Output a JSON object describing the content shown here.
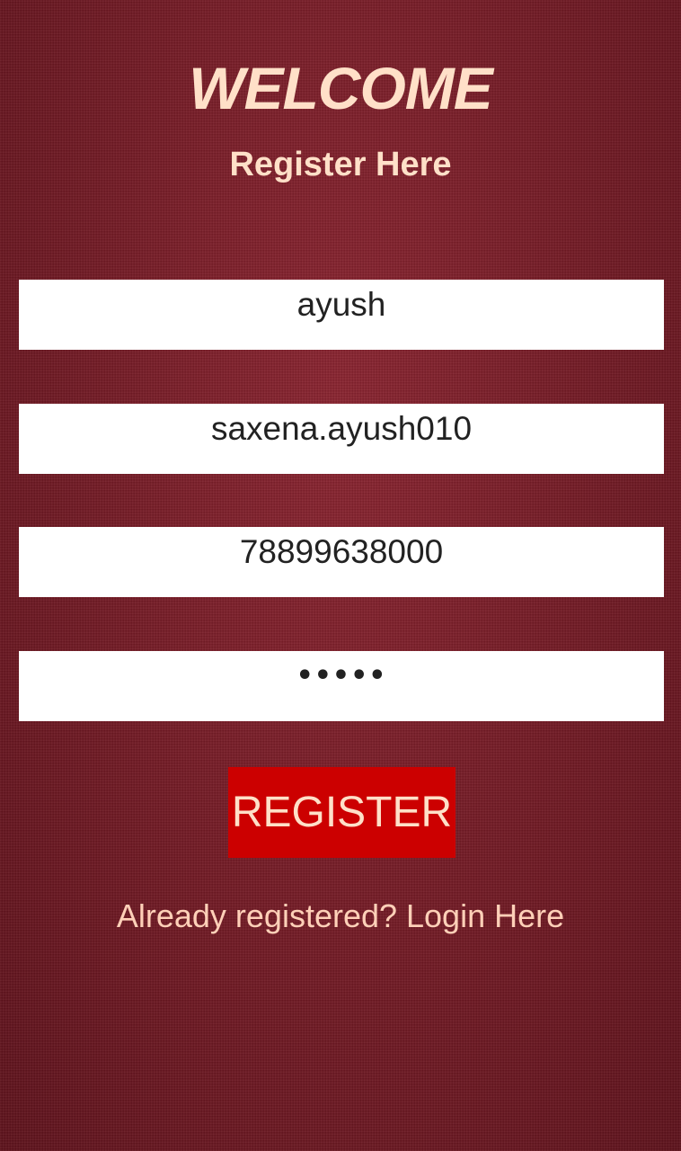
{
  "header": {
    "title": "WELCOME",
    "subtitle": "Register Here"
  },
  "form": {
    "name_value": "ayush",
    "username_value": "saxena.ayush010",
    "phone_value": "78899638000",
    "password_value": "•••••"
  },
  "actions": {
    "register_label": "REGISTER",
    "login_link": "Already registered? Login Here"
  },
  "colors": {
    "background": "#7a1d27",
    "heading_text": "#ffe0c8",
    "button": "#cc0000",
    "field_background": "#ffffff"
  }
}
